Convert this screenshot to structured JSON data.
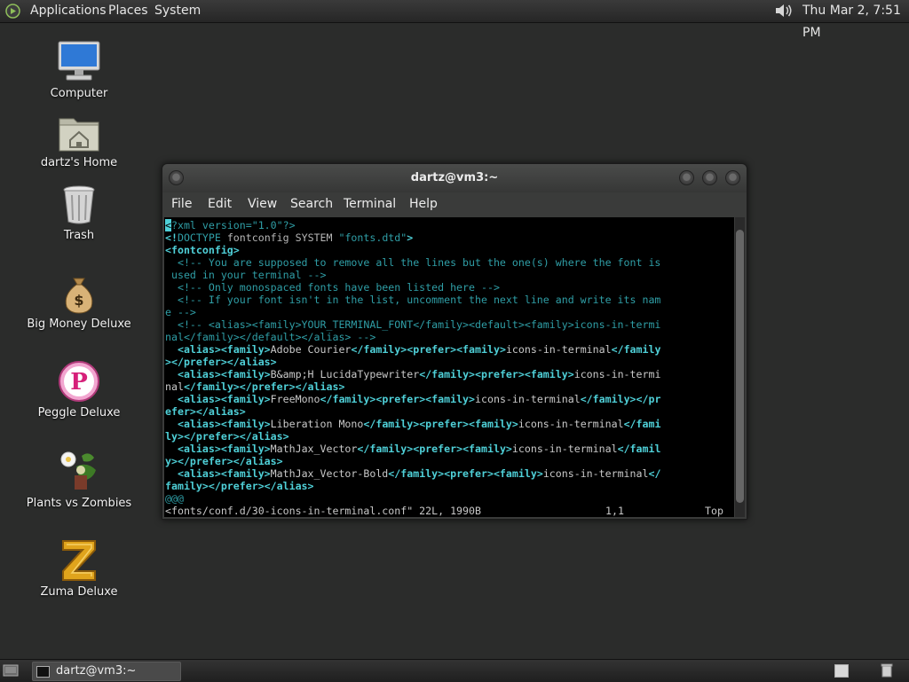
{
  "top_panel": {
    "menus": {
      "applications": "Applications",
      "places": "Places",
      "system": "System"
    },
    "clock": "Thu Mar  2,  7:51 PM"
  },
  "desktop": {
    "icons": [
      {
        "label": "Computer"
      },
      {
        "label": "dartz's Home"
      },
      {
        "label": "Trash"
      },
      {
        "label": "Big Money Deluxe"
      },
      {
        "label": "Peggle Deluxe"
      },
      {
        "label": "Plants vs Zombies"
      },
      {
        "label": "Zuma Deluxe"
      }
    ]
  },
  "terminal": {
    "title": "dartz@vm3:~",
    "menu": {
      "file": "File",
      "edit": "Edit",
      "view": "View",
      "search": "Search",
      "terminal": "Terminal",
      "help": "Help"
    },
    "lines": [
      [
        {
          "t": "<",
          "c": "cursor"
        },
        {
          "t": "?xml version=\"1.0\"?>",
          "c": "c-com"
        }
      ],
      [
        {
          "t": "<!",
          "c": "c-tag"
        },
        {
          "t": "DOCTYPE",
          "c": "c-com"
        },
        {
          "t": " fontconfig SYSTEM ",
          "c": "c-norm"
        },
        {
          "t": "\"fonts.dtd\"",
          "c": "c-com"
        },
        {
          "t": ">",
          "c": "c-tag"
        }
      ],
      [
        {
          "t": "<fontconfig>",
          "c": "c-tag"
        }
      ],
      [
        {
          "t": "  <!-- You are supposed to remove all the lines but the one(s) where the font is",
          "c": "c-com"
        }
      ],
      [
        {
          "t": " used in your terminal -->",
          "c": "c-com"
        }
      ],
      [
        {
          "t": "  <!-- Only monospaced fonts have been listed here -->",
          "c": "c-com"
        }
      ],
      [
        {
          "t": "  <!-- If your font isn't in the list, uncomment the next line and write its nam",
          "c": "c-com"
        }
      ],
      [
        {
          "t": "e -->",
          "c": "c-com"
        }
      ],
      [
        {
          "t": "  <!-- <alias><family>YOUR_TERMINAL_FONT</family><default><family>icons-in-termi",
          "c": "c-com"
        }
      ],
      [
        {
          "t": "nal</family></default></alias> -->",
          "c": "c-com"
        }
      ],
      [
        {
          "t": "  <alias><family>",
          "c": "c-tag"
        },
        {
          "t": "Adobe Courier",
          "c": "c-str"
        },
        {
          "t": "</family><prefer><family>",
          "c": "c-tag"
        },
        {
          "t": "icons-in-terminal",
          "c": "c-str"
        },
        {
          "t": "</family",
          "c": "c-tag"
        }
      ],
      [
        {
          "t": "></prefer></alias>",
          "c": "c-tag"
        }
      ],
      [
        {
          "t": "  <alias><family>",
          "c": "c-tag"
        },
        {
          "t": "B&amp;H LucidaTypewriter",
          "c": "c-str"
        },
        {
          "t": "</family><prefer><family>",
          "c": "c-tag"
        },
        {
          "t": "icons-in-termi",
          "c": "c-str"
        }
      ],
      [
        {
          "t": "nal",
          "c": "c-str"
        },
        {
          "t": "</family></prefer></alias>",
          "c": "c-tag"
        }
      ],
      [
        {
          "t": "  <alias><family>",
          "c": "c-tag"
        },
        {
          "t": "FreeMono",
          "c": "c-str"
        },
        {
          "t": "</family><prefer><family>",
          "c": "c-tag"
        },
        {
          "t": "icons-in-terminal",
          "c": "c-str"
        },
        {
          "t": "</family></pr",
          "c": "c-tag"
        }
      ],
      [
        {
          "t": "efer></alias>",
          "c": "c-tag"
        }
      ],
      [
        {
          "t": "  <alias><family>",
          "c": "c-tag"
        },
        {
          "t": "Liberation Mono",
          "c": "c-str"
        },
        {
          "t": "</family><prefer><family>",
          "c": "c-tag"
        },
        {
          "t": "icons-in-terminal",
          "c": "c-str"
        },
        {
          "t": "</fami",
          "c": "c-tag"
        }
      ],
      [
        {
          "t": "ly></prefer></alias>",
          "c": "c-tag"
        }
      ],
      [
        {
          "t": "  <alias><family>",
          "c": "c-tag"
        },
        {
          "t": "MathJax_Vector",
          "c": "c-str"
        },
        {
          "t": "</family><prefer><family>",
          "c": "c-tag"
        },
        {
          "t": "icons-in-terminal",
          "c": "c-str"
        },
        {
          "t": "</famil",
          "c": "c-tag"
        }
      ],
      [
        {
          "t": "y></prefer></alias>",
          "c": "c-tag"
        }
      ],
      [
        {
          "t": "  <alias><family>",
          "c": "c-tag"
        },
        {
          "t": "MathJax_Vector-Bold",
          "c": "c-str"
        },
        {
          "t": "</family><prefer><family>",
          "c": "c-tag"
        },
        {
          "t": "icons-in-terminal",
          "c": "c-str"
        },
        {
          "t": "</",
          "c": "c-tag"
        }
      ],
      [
        {
          "t": "family></prefer></alias>",
          "c": "c-tag"
        }
      ],
      [
        {
          "t": "@@@",
          "c": "c-blank"
        }
      ]
    ],
    "status": {
      "file": "<fonts/conf.d/30-icons-in-terminal.conf\" 22L, 1990B",
      "position": "1,1",
      "scroll": "Top"
    }
  },
  "taskbar": {
    "item_label": "dartz@vm3:~"
  }
}
